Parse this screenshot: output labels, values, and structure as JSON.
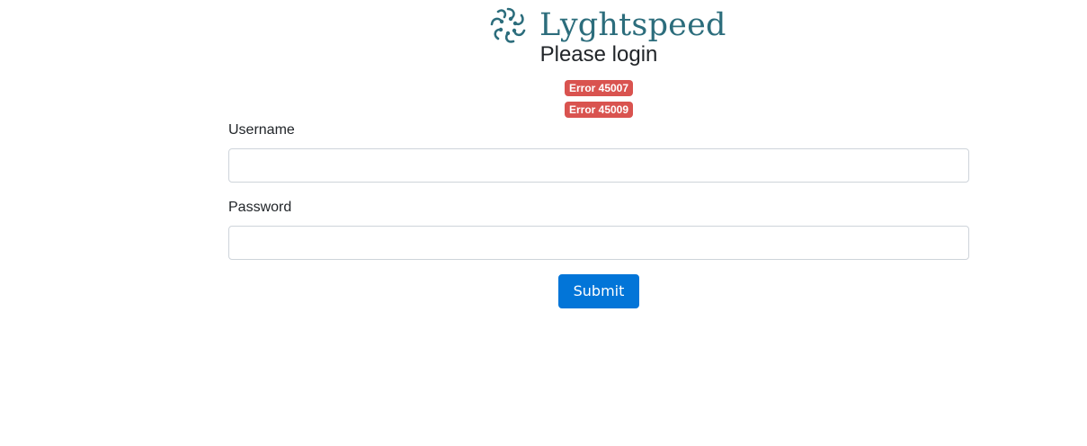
{
  "brand": {
    "name": "Lyghtspeed",
    "icon": "lyghtspeed-logo-icon",
    "color": "#2c6d7c"
  },
  "login": {
    "title": "Please login",
    "errors": [
      "Error 45007",
      "Error 45009"
    ],
    "error_color": "#d9534f",
    "username_label": "Username",
    "username_value": "",
    "password_label": "Password",
    "password_value": "",
    "submit_label": "Submit",
    "submit_color": "#0275d8"
  }
}
